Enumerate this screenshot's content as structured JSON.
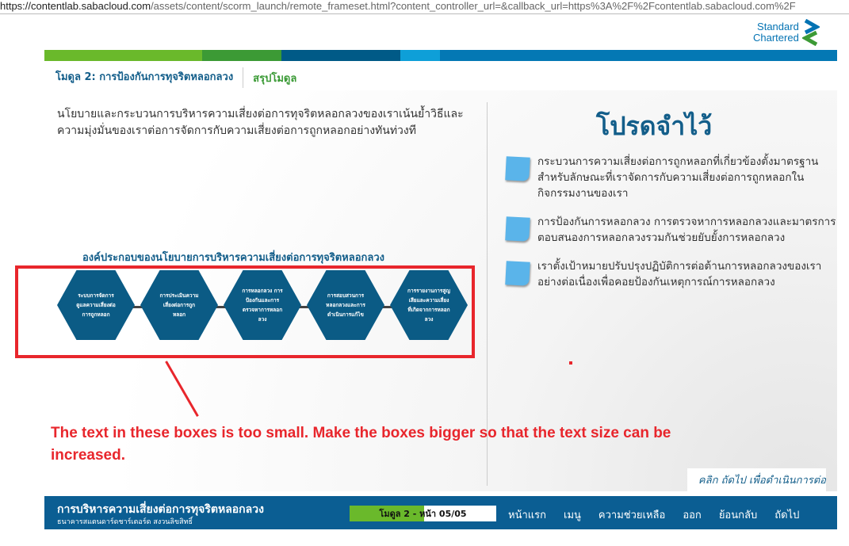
{
  "browser": {
    "url_domain": "https://contentlab.sabacloud.com",
    "url_rest": "/assets/content/scorm_launch/remote_frameset.html?content_controller_url=&callback_url=https%3A%2F%2Fcontentlab.sabacloud.com%2F"
  },
  "logo": {
    "line1": "Standard",
    "line2": "Chartered"
  },
  "colors": {
    "bar": [
      "#6ab92b",
      "#3c9a35",
      "#005a87",
      "#0e9fd8",
      "#0478b4"
    ],
    "annotation": "#e8262c",
    "primary": "#0b5e93"
  },
  "header": {
    "module": "โมดูล 2: การป้องกันการทุจริตหลอกลวง",
    "section": "สรุปโมดูล"
  },
  "intro": "นโยบายและกระบวนการบริหารความเสี่ยงต่อการทุจริตหลอกลวงของเราเน้นย้ำวิธีและความมุ่งมั่นของเราต่อการจัดการกับความเสี่ยงต่อการถูกหลอกอย่างทันท่วงที",
  "diagram": {
    "title": "องค์ประกอบของนโยบายการบริหารความเสี่ยงต่อการทุจริตหลอกลวง",
    "items": [
      "ระบบการจัดการดูแลความเสี่ยงต่อการถูกหลอก",
      "การประเมินความเสี่ยงต่อการถูกหลอก",
      "การหลอกลวง การป้องกันและการตรวจหาการหลอกลวง",
      "การสอบสวนการหลอกลวงและการดำเนินการแก้ไข",
      "การรายงานการสูญเสียและความเสี่ยงที่เกิดจากการหลอกลวง"
    ]
  },
  "remember": {
    "title": "โปรดจำไว้",
    "bullets": [
      "กระบวนการความเสี่ยงต่อการถูกหลอกที่เกี่ยวข้องตั้งมาตรฐานสำหรับลักษณะที่เราจัดการกับความเสี่ยงต่อการถูกหลอกในกิจกรรมงานของเรา",
      "การป้องกันการหลอกลวง การตรวจหาการหลอกลวงและมาตรการตอบสนองการหลอกลวงรวมกันช่วยยับยั้งการหลอกลวง",
      "เราตั้งเป้าหมายปรับปรุงปฏิบัติการต่อต้านการหลอกลวงของเราอย่างต่อเนื่องเพื่อคอยป้องกันเหตุการณ์การหลอกลวง"
    ]
  },
  "click_next": "คลิก ถัดไป เพื่อดำเนินการต่อ",
  "annotation": "The text in these boxes is too small. Make the boxes bigger so that the text size can be increased.",
  "footer": {
    "title": "การบริหารความเสี่ยงต่อการทุจริตหลอกลวง",
    "subtitle": "ธนาคารสแตนดาร์ดชาร์เตอร์ด สงวนลิขสิทธิ์",
    "progress_label": "โมดูล 2 - หน้า 05/05",
    "progress_fraction": 0.51,
    "nav": [
      "หน้าแรก",
      "เมนู",
      "ความช่วยเหลือ",
      "ออก",
      "ย้อนกลับ",
      "ถัดไป"
    ]
  }
}
